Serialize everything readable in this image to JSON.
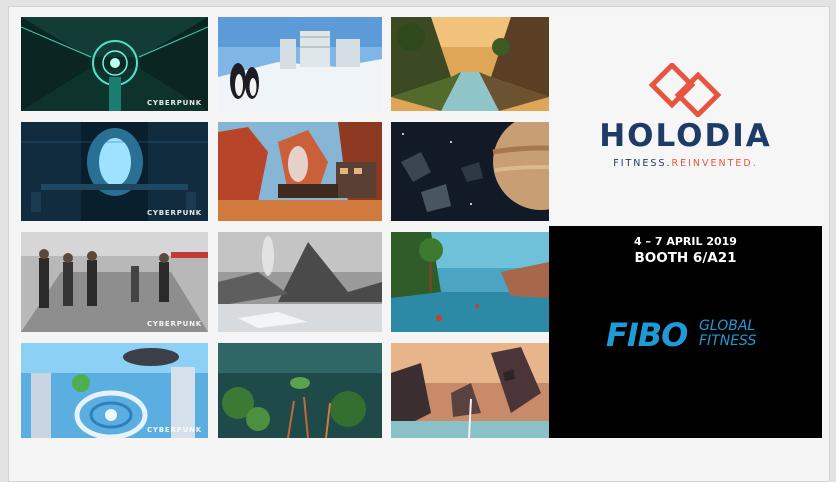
{
  "gallery": {
    "watermark": "CYBERPUNK",
    "tiles": [
      {
        "scene": "cyber-tunnel",
        "watermark": true
      },
      {
        "scene": "arctic-penguins",
        "watermark": false
      },
      {
        "scene": "jungle-river",
        "watermark": false
      },
      {
        "scene": "cyber-reactor",
        "watermark": true
      },
      {
        "scene": "canyon-train",
        "watermark": false
      },
      {
        "scene": "space-planet",
        "watermark": false
      },
      {
        "scene": "gym-users",
        "watermark": true
      },
      {
        "scene": "volcano-coast",
        "watermark": false
      },
      {
        "scene": "tropical-lagoon",
        "watermark": false
      },
      {
        "scene": "futuristic-city",
        "watermark": true
      },
      {
        "scene": "underwater-reef",
        "watermark": false
      },
      {
        "scene": "sunset-canyon",
        "watermark": false
      }
    ]
  },
  "brand": {
    "name": "HOLODIA",
    "tagline_part1": "FITNESS.",
    "tagline_part2": "REINVENTED.",
    "colors": {
      "navy": "#1e3a66",
      "accent": "#e8553e"
    }
  },
  "event": {
    "dates": "4 – 7 APRIL 2019",
    "booth": "BOOTH 6/A21",
    "logo_text": "FIBO",
    "logo_sub_line1": "GLOBAL",
    "logo_sub_line2": "FITNESS",
    "color": "#1e9bd7"
  }
}
